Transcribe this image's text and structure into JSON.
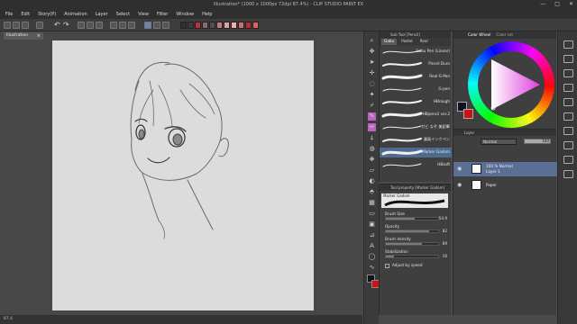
{
  "window": {
    "title": "Illustration* (1000 x 1000px 72dpi 87.4%)  - CLIP STUDIO PAINT EX",
    "controls": [
      "—",
      "□",
      "✕"
    ]
  },
  "menu": [
    "File",
    "Edit",
    "Story(P)",
    "Animation",
    "Layer",
    "Select",
    "View",
    "Filter",
    "Window",
    "Help"
  ],
  "toolbar": {
    "swatch_colors": [
      "#2f2f3f",
      "#3c3c44",
      "#c03040",
      "#8a6a70",
      "#5a4a50",
      "#c07a7a",
      "#e0a0a0",
      "#f0b0b0",
      "#d07070",
      "#b03030",
      "#e06060"
    ]
  },
  "canvas": {
    "tab_label": "Illustration",
    "status_zoom": "87.4"
  },
  "subtool": {
    "tab_title": "Sub Tool [Pencil]",
    "tabs": [
      "Gabu",
      "Pastel",
      "Real"
    ],
    "brushes": [
      {
        "label": "Gabu Pen (Linear)"
      },
      {
        "label": "Pincel Duro"
      },
      {
        "label": "Real G-Pen"
      },
      {
        "label": "G-pen"
      },
      {
        "label": "HBrough"
      },
      {
        "label": "HBpencil ver.2"
      },
      {
        "label": "ガビ なぞ 美鉛筆"
      },
      {
        "label": "漫画インクペン"
      },
      {
        "label": "Marker Gadom"
      },
      {
        "label": "HBsoft"
      }
    ],
    "selected_index": 8
  },
  "toolproperty": {
    "title": "Tool property [Marker Gadom]",
    "preset_label": "Marker Gadom",
    "rows": [
      {
        "label": "Brush Size",
        "value": "54.9",
        "fill": 0.55
      },
      {
        "label": "Opacity",
        "value": "82",
        "fill": 0.82
      },
      {
        "label": "Brush density",
        "value": "69",
        "fill": 0.69
      },
      {
        "label": "Stabilization",
        "value": "16",
        "fill": 0.16
      }
    ],
    "checkbox_label": "Adjust by speed"
  },
  "colorpanel": {
    "tabs": [
      "Color Wheel",
      "Color set"
    ],
    "hue_color": "#e040e0",
    "main_color": "#101020",
    "sub_color": "#cc1111",
    "values": "322  0  0"
  },
  "layerpanel": {
    "title": "Layer",
    "blend_mode": "Normal",
    "opacity_value": "100",
    "layers": [
      {
        "title": "100 % Normal",
        "name": "Layer 1",
        "selected": true
      },
      {
        "title": "",
        "name": "Paper",
        "selected": false
      }
    ]
  }
}
